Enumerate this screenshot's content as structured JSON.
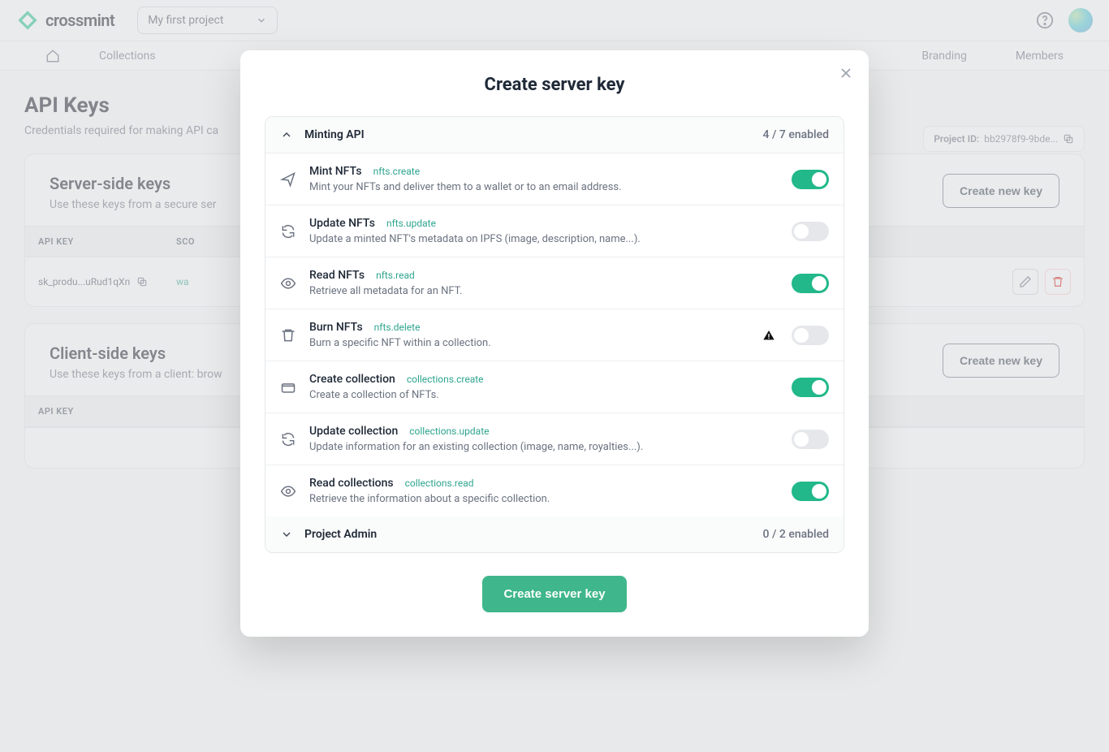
{
  "header": {
    "brand": "crossmint",
    "project_selector": "My first project"
  },
  "nav": {
    "collections": "Collections",
    "branding": "Branding",
    "members": "Members"
  },
  "page": {
    "title": "API Keys",
    "subtitle": "Credentials required for making API ca",
    "project_id_label": "Project ID:",
    "project_id_value": "bb2978f9-9bde..."
  },
  "server_card": {
    "title": "Server-side keys",
    "subtitle": "Use these keys from a secure ser",
    "create_btn": "Create new key",
    "th_key": "API KEY",
    "th_scope": "SCO",
    "row_key": "sk_produ...uRud1qXn",
    "row_scope": "wa"
  },
  "client_card": {
    "title": "Client-side keys",
    "subtitle": "Use these keys from a client: brow",
    "create_btn": "Create new key",
    "th_key": "API KEY"
  },
  "modal": {
    "title": "Create server key",
    "submit": "Create server key",
    "sections": {
      "minting": {
        "title": "Minting API",
        "count": "4 / 7 enabled"
      },
      "admin": {
        "title": "Project Admin",
        "count": "0 / 2 enabled"
      }
    },
    "perms": [
      {
        "name": "Mint NFTs",
        "scope": "nfts.create",
        "desc": "Mint your NFTs and deliver them to a wallet or to an email address.",
        "on": true,
        "icon": "send"
      },
      {
        "name": "Update NFTs",
        "scope": "nfts.update",
        "desc": "Update a minted NFT's metadata on IPFS (image, description, name...).",
        "on": false,
        "icon": "refresh"
      },
      {
        "name": "Read NFTs",
        "scope": "nfts.read",
        "desc": "Retrieve all metadata for an NFT.",
        "on": true,
        "icon": "eye"
      },
      {
        "name": "Burn NFTs",
        "scope": "nfts.delete",
        "desc": "Burn a specific NFT within a collection.",
        "on": false,
        "icon": "trash",
        "warn": true
      },
      {
        "name": "Create collection",
        "scope": "collections.create",
        "desc": "Create a collection of NFTs.",
        "on": true,
        "icon": "wallet"
      },
      {
        "name": "Update collection",
        "scope": "collections.update",
        "desc": "Update information for an existing collection (image, name, royalties...).",
        "on": false,
        "icon": "refresh"
      },
      {
        "name": "Read collections",
        "scope": "collections.read",
        "desc": "Retrieve the information about a specific collection.",
        "on": true,
        "icon": "eye"
      }
    ]
  }
}
